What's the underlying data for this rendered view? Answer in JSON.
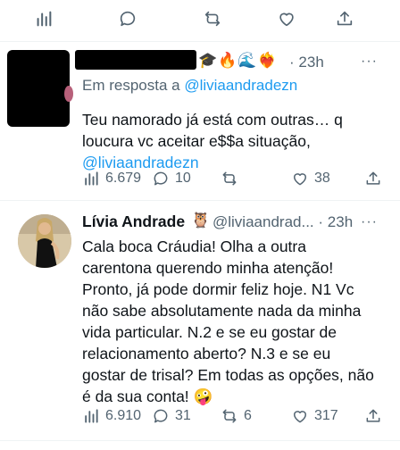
{
  "top_bar": {
    "icons": [
      "analytics-icon",
      "reply-icon",
      "retweet-icon",
      "like-icon",
      "share-icon"
    ]
  },
  "tweet1": {
    "emojis": "🎓🔥🌊❤️‍🔥",
    "separator": "·",
    "time": "23h",
    "more": "···",
    "reply_prefix": "Em resposta a",
    "reply_handle": "@liviaandradezn",
    "text": "Teu namorado já está com outras… q loucura vc aceitar e$$a situação,",
    "text_mention": "@liviaandradezn",
    "views": "6.679",
    "replies": "10",
    "retweets": "",
    "likes": "38"
  },
  "tweet2": {
    "name": "Lívia Andrade",
    "badge": "🦉",
    "handle": "@liviaandrad...",
    "separator": "·",
    "time": "23h",
    "more": "···",
    "text": "Cala boca Cráudia! Olha a outra carentona querendo minha atenção! Pronto, já pode dormir feliz hoje. N1 Vc não sabe absolutamente nada da minha vida particular. N.2 e se eu gostar de relacionamento aberto? N.3 e se eu gostar de trisal? Em todas as opções, não é da sua conta! 🤪",
    "views": "6.910",
    "replies": "31",
    "retweets": "6",
    "likes": "317"
  },
  "colors": {
    "text": "#0f1419",
    "secondary": "#536471",
    "link": "#1d9bf0",
    "divider": "#eff3f4"
  }
}
